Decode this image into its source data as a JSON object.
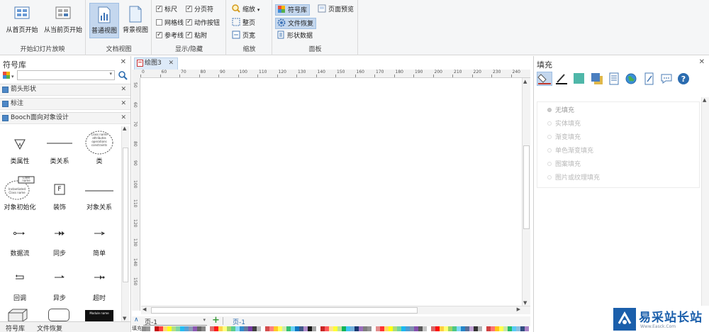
{
  "ribbon": {
    "groups": [
      {
        "title": "开始幻灯片放映"
      },
      {
        "title": "文档视图"
      },
      {
        "title": "显示/隐藏"
      },
      {
        "title": "缩放"
      },
      {
        "title": "面板"
      }
    ],
    "slideshow": {
      "from_start": "从首页开始",
      "from_current": "从当前页开始"
    },
    "docview": {
      "normal_view": "普通视图",
      "background_view": "背景视图"
    },
    "showhide": {
      "ruler": {
        "label": "标尺",
        "checked": true
      },
      "page_break": {
        "label": "分页符",
        "checked": true
      },
      "grid": {
        "label": "网格线",
        "checked": false
      },
      "action_button": {
        "label": "动作按钮",
        "checked": true
      },
      "guides": {
        "label": "参考线",
        "checked": true
      },
      "snap": {
        "label": "粘附",
        "checked": true
      }
    },
    "zoom": {
      "zoom": "缩放",
      "whole_page": "整页",
      "page_width": "页宽"
    },
    "panels": {
      "symbols": "符号库",
      "file_recovery": "文件恢复",
      "shape_data": "形状数据",
      "page_preview": "页面预览"
    }
  },
  "left_panel": {
    "title": "符号库",
    "categories": [
      "箭头形状",
      "标注",
      "Booch面向对象设计"
    ],
    "shapes": [
      "类属性",
      "类关系",
      "类",
      "对象初始化",
      "装饰",
      "对象关系",
      "数据流",
      "同步",
      "简单",
      "回调",
      "异步",
      "超时"
    ],
    "bottom_tabs": [
      "符号库",
      "文件恢复"
    ],
    "preview_texts": {
      "class_cloud": [
        "Class name",
        "attributes",
        "operations",
        "constraints"
      ],
      "init_box": [
        "Class",
        "name"
      ],
      "init_cloud": [
        "Instantiated",
        "Class name"
      ],
      "decor": "F",
      "module": "Module name"
    }
  },
  "document": {
    "tab": "绘图3",
    "ruler_h": [
      "0",
      "60",
      "70",
      "80",
      "90",
      "100",
      "110",
      "120",
      "130",
      "140",
      "150",
      "160",
      "170",
      "180",
      "190",
      "200",
      "210",
      "220",
      "230",
      "240"
    ],
    "ruler_v": [
      "50",
      "60",
      "70",
      "80",
      "90",
      "100",
      "110",
      "120",
      "130",
      "140",
      "150"
    ],
    "page_select": "页-1",
    "page_tab": "页-1",
    "palette_label": "填充"
  },
  "right_panel": {
    "title": "填充",
    "options": [
      "无填充",
      "实体填充",
      "渐变填充",
      "单色渐变填充",
      "图案填充",
      "图片或纹理填充"
    ],
    "selected_option": "无填充"
  },
  "watermark": {
    "brand": "易采站长站",
    "subtitle": "Www.Easck.Com"
  },
  "colors": {
    "ribbon_selected": "#c4d7ee",
    "accent": "#2b6cb0",
    "palette": [
      "#000000",
      "#7f7f7f",
      "#ffffff",
      "#c00000",
      "#ff0000",
      "#ffc000",
      "#ffff00",
      "#92d050",
      "#00b050",
      "#00b0f0",
      "#0070c0",
      "#002060",
      "#7030a0"
    ]
  }
}
